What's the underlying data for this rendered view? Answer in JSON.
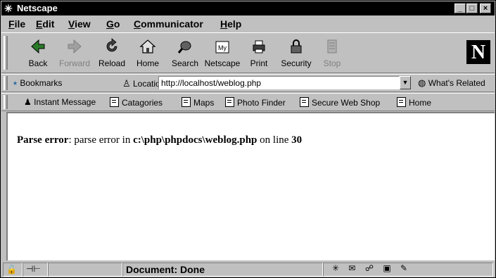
{
  "window": {
    "title": "Netscape"
  },
  "menu": {
    "items": [
      {
        "label": "File",
        "accel": "F",
        "rest": "ile"
      },
      {
        "label": "Edit",
        "accel": "E",
        "rest": "dit"
      },
      {
        "label": "View",
        "accel": "V",
        "rest": "iew"
      },
      {
        "label": "Go",
        "accel": "G",
        "rest": "o"
      },
      {
        "label": "Communicator",
        "accel": "C",
        "rest": "ommunicator"
      },
      {
        "label": "Help",
        "accel": "H",
        "rest": "elp"
      }
    ]
  },
  "toolbar": {
    "buttons": [
      {
        "label": "Back",
        "icon": "back-arrow-icon",
        "enabled": true
      },
      {
        "label": "Forward",
        "icon": "forward-arrow-icon",
        "enabled": false
      },
      {
        "label": "Reload",
        "icon": "reload-icon",
        "enabled": true
      },
      {
        "label": "Home",
        "icon": "home-icon",
        "enabled": true
      },
      {
        "label": "Search",
        "icon": "search-icon",
        "enabled": true
      },
      {
        "label": "Netscape",
        "icon": "my-netscape-icon",
        "enabled": true
      },
      {
        "label": "Print",
        "icon": "printer-icon",
        "enabled": true
      },
      {
        "label": "Security",
        "icon": "padlock-icon",
        "enabled": true
      },
      {
        "label": "Stop",
        "icon": "stop-icon",
        "enabled": false
      }
    ],
    "logo": "N"
  },
  "location_bar": {
    "bookmarks_label": "Bookmarks",
    "location_label": "Location:",
    "url": "http://localhost/weblog.php",
    "related_label": "What's Related"
  },
  "personal_toolbar": {
    "items": [
      {
        "label": "Instant Message"
      },
      {
        "label": "Catagories"
      },
      {
        "label": "Maps"
      },
      {
        "label": "Photo Finder"
      },
      {
        "label": "Secure Web Shop"
      },
      {
        "label": "Home"
      }
    ]
  },
  "page": {
    "error_label": "Parse error",
    "error_text": ": parse error in ",
    "error_file": "c:\\php\\phpdocs\\weblog.php",
    "error_on_line": " on line ",
    "error_line": "30"
  },
  "status": {
    "text": "Document: Done"
  }
}
